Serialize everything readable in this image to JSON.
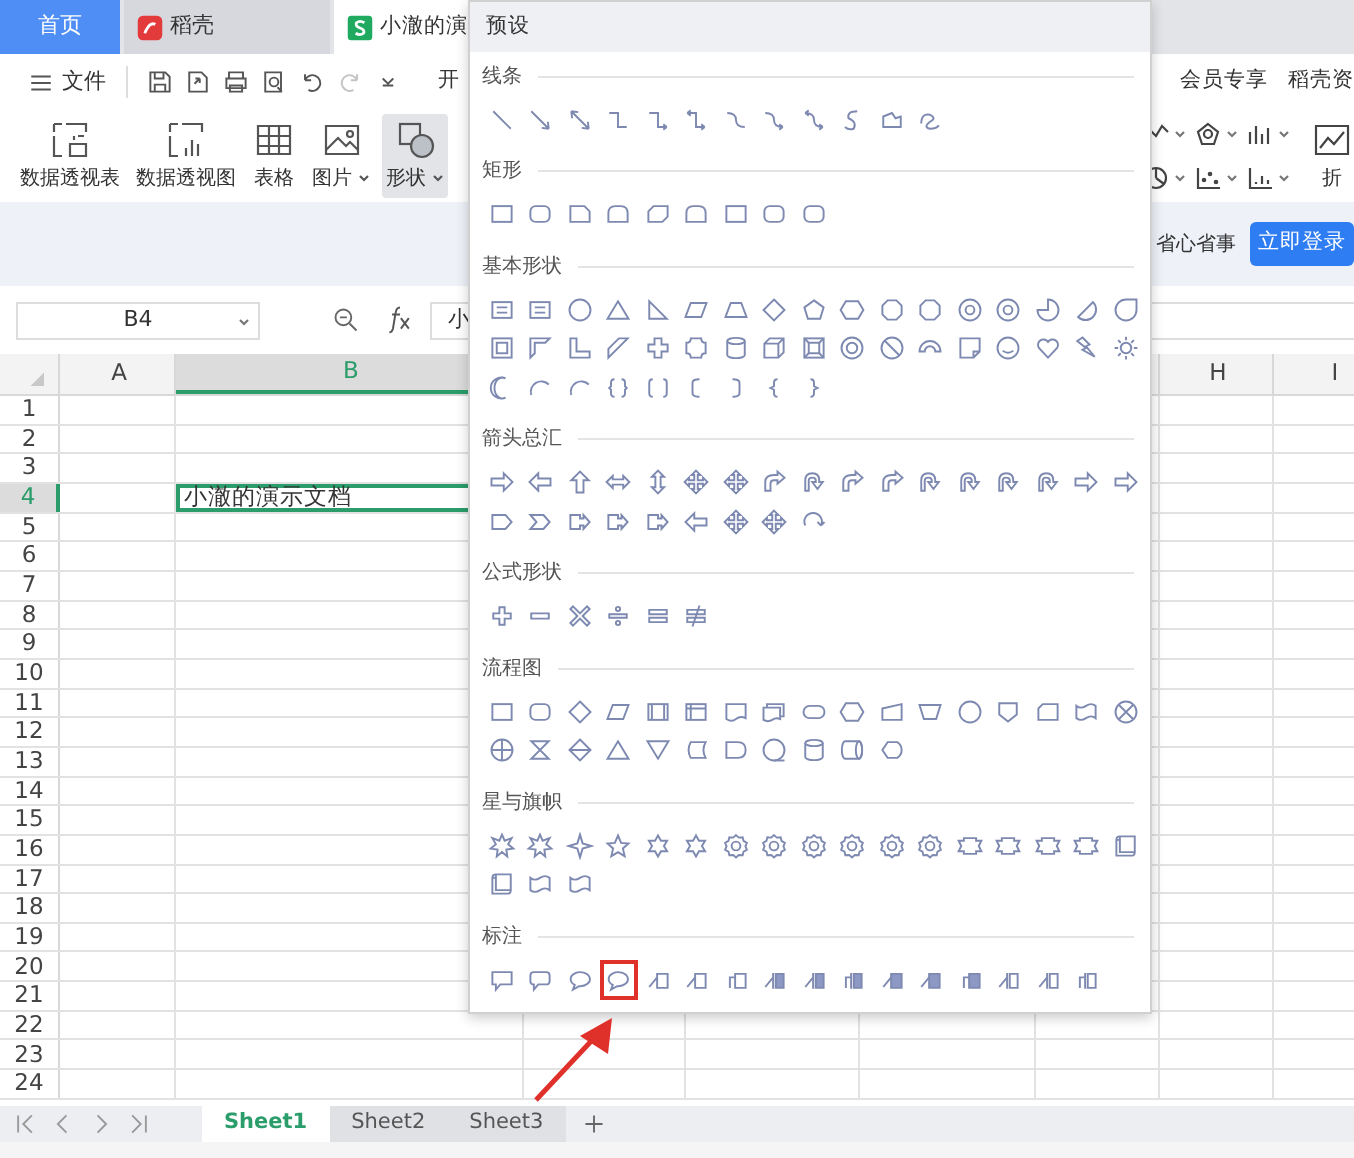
{
  "tabs": [
    {
      "label": "首页",
      "kind": "home",
      "selected": false
    },
    {
      "label": "稻壳",
      "kind": "docer",
      "selected": false
    },
    {
      "label": "小澈的演",
      "kind": "sheet",
      "selected": true
    }
  ],
  "toolbar": {
    "menu": "文件",
    "quick_access": [
      {
        "kind": "save",
        "disabled": false
      },
      {
        "kind": "export",
        "disabled": false
      },
      {
        "kind": "print",
        "disabled": false
      },
      {
        "kind": "preview",
        "disabled": false
      },
      {
        "kind": "undo",
        "disabled": false
      },
      {
        "kind": "redo",
        "disabled": true
      },
      {
        "kind": "more",
        "disabled": false
      }
    ],
    "next_tab": "开",
    "right_tabs": [
      "会员专享",
      "稻壳资"
    ]
  },
  "ribbon": [
    {
      "label": "数据透视表",
      "kind": "pivot-table",
      "caret": false,
      "selected": false
    },
    {
      "label": "数据透视图",
      "kind": "pivot-chart",
      "caret": false,
      "selected": false
    },
    {
      "label": "表格",
      "kind": "table",
      "caret": false,
      "selected": false
    },
    {
      "label": "图片",
      "kind": "picture",
      "caret": true,
      "selected": false
    },
    {
      "label": "形状",
      "kind": "shapes",
      "caret": true,
      "selected": true
    }
  ],
  "ribbon_right": {
    "label": "折"
  },
  "promo": {
    "text": "省心省事",
    "button": "立即登录"
  },
  "formula_bar": {
    "cell_ref": "B4",
    "value": "小"
  },
  "sheet": {
    "columns": [
      {
        "label": "A",
        "selected": false
      },
      {
        "label": "B",
        "selected": true
      },
      {
        "label": "H",
        "selected": false
      },
      {
        "label": "I",
        "selected": false
      }
    ],
    "rows": [
      {
        "number": "1",
        "selected": false
      },
      {
        "number": "2",
        "selected": false
      },
      {
        "number": "3",
        "selected": false
      },
      {
        "number": "4",
        "selected": true,
        "B": "小澈的演示文档"
      },
      {
        "number": "5",
        "selected": false
      },
      {
        "number": "6",
        "selected": false
      },
      {
        "number": "7",
        "selected": false
      },
      {
        "number": "8",
        "selected": false
      },
      {
        "number": "9",
        "selected": false
      },
      {
        "number": "10",
        "selected": false
      },
      {
        "number": "11",
        "selected": false
      },
      {
        "number": "12",
        "selected": false
      },
      {
        "number": "13",
        "selected": false
      },
      {
        "number": "14",
        "selected": false
      },
      {
        "number": "15",
        "selected": false
      },
      {
        "number": "16",
        "selected": false
      },
      {
        "number": "17",
        "selected": false
      },
      {
        "number": "18",
        "selected": false
      },
      {
        "number": "19",
        "selected": false
      },
      {
        "number": "20",
        "selected": false
      },
      {
        "number": "21",
        "selected": false
      },
      {
        "number": "22",
        "selected": false
      },
      {
        "number": "23",
        "selected": false
      },
      {
        "number": "24",
        "selected": false
      }
    ]
  },
  "sheet_tabs": [
    {
      "label": "Sheet1",
      "selected": true
    },
    {
      "label": "Sheet2",
      "selected": false
    },
    {
      "label": "Sheet3",
      "selected": false
    }
  ],
  "shape_menu": {
    "title": "预设",
    "sections": [
      {
        "title": "线条",
        "shapes": [
          {
            "kind": "line",
            "selected": false
          },
          {
            "kind": "arrow-line",
            "selected": false
          },
          {
            "kind": "dbl-arrow-line",
            "selected": false
          },
          {
            "kind": "elbow",
            "selected": false
          },
          {
            "kind": "elbow-arrow",
            "selected": false
          },
          {
            "kind": "elbow-dbl",
            "selected": false
          },
          {
            "kind": "curve",
            "selected": false
          },
          {
            "kind": "curve-arrow",
            "selected": false
          },
          {
            "kind": "curve-dbl",
            "selected": false
          },
          {
            "kind": "s-curve",
            "selected": false
          },
          {
            "kind": "freeform",
            "selected": false
          },
          {
            "kind": "scribble",
            "selected": false
          }
        ]
      },
      {
        "title": "矩形",
        "shapes": [
          {
            "kind": "rect",
            "selected": false
          },
          {
            "kind": "round-rect",
            "selected": false
          },
          {
            "kind": "snip-rect",
            "selected": false
          },
          {
            "kind": "round-top",
            "selected": false
          },
          {
            "kind": "snip-diag",
            "selected": false
          },
          {
            "kind": "round-top",
            "selected": false
          },
          {
            "kind": "rect",
            "selected": false
          },
          {
            "kind": "round-rect",
            "selected": false
          },
          {
            "kind": "round-rect",
            "selected": false
          }
        ]
      },
      {
        "title": "基本形状",
        "shapes": [
          {
            "kind": "text-box",
            "selected": false
          },
          {
            "kind": "text-box",
            "selected": false
          },
          {
            "kind": "oval",
            "selected": false
          },
          {
            "kind": "triangle",
            "selected": false
          },
          {
            "kind": "right-triangle",
            "selected": false
          },
          {
            "kind": "parallelogram",
            "selected": false
          },
          {
            "kind": "trapezoid",
            "selected": false
          },
          {
            "kind": "diamond",
            "selected": false
          },
          {
            "kind": "pentagon",
            "selected": false
          },
          {
            "kind": "hexagon",
            "selected": false
          },
          {
            "kind": "octagon",
            "selected": false
          },
          {
            "kind": "octagon",
            "selected": false
          },
          {
            "kind": "badge",
            "selected": false
          },
          {
            "kind": "badge",
            "selected": false
          },
          {
            "kind": "pie",
            "selected": false
          },
          {
            "kind": "chord",
            "selected": false
          },
          {
            "kind": "teardrop",
            "selected": false
          },
          {
            "kind": "frame",
            "selected": false
          },
          {
            "kind": "half-frame",
            "selected": false
          },
          {
            "kind": "l-shape",
            "selected": false
          },
          {
            "kind": "diag-stripe",
            "selected": false
          },
          {
            "kind": "cross",
            "selected": false
          },
          {
            "kind": "plaque",
            "selected": false
          },
          {
            "kind": "can",
            "selected": false
          },
          {
            "kind": "cube",
            "selected": false
          },
          {
            "kind": "bevel",
            "selected": false
          },
          {
            "kind": "donut",
            "selected": false
          },
          {
            "kind": "no-symbol",
            "selected": false
          },
          {
            "kind": "block-arc",
            "selected": false
          },
          {
            "kind": "folded-corner",
            "selected": false
          },
          {
            "kind": "smiley",
            "selected": false
          },
          {
            "kind": "heart",
            "selected": false
          },
          {
            "kind": "lightning",
            "selected": false
          },
          {
            "kind": "sun",
            "selected": false
          },
          {
            "kind": "moon",
            "selected": false
          },
          {
            "kind": "arc",
            "selected": false
          },
          {
            "kind": "arc",
            "selected": false
          },
          {
            "kind": "double-brace",
            "selected": false
          },
          {
            "kind": "double-bracket",
            "selected": false
          },
          {
            "kind": "left-bracket",
            "selected": false
          },
          {
            "kind": "right-bracket",
            "selected": false
          },
          {
            "kind": "left-brace",
            "selected": false
          },
          {
            "kind": "right-brace",
            "selected": false
          }
        ]
      },
      {
        "title": "箭头总汇",
        "shapes": [
          {
            "kind": "right-arrow",
            "selected": false
          },
          {
            "kind": "left-arrow",
            "selected": false
          },
          {
            "kind": "up-arrow",
            "selected": false
          },
          {
            "kind": "left-right-arrow",
            "selected": false
          },
          {
            "kind": "up-down-arrow",
            "selected": false
          },
          {
            "kind": "quad-arrow",
            "selected": false
          },
          {
            "kind": "quad-arrow",
            "selected": false
          },
          {
            "kind": "bent-arrow",
            "selected": false
          },
          {
            "kind": "u-turn-arrow",
            "selected": false
          },
          {
            "kind": "bent-arrow",
            "selected": false
          },
          {
            "kind": "bent-arrow",
            "selected": false
          },
          {
            "kind": "u-turn-arrow",
            "selected": false
          },
          {
            "kind": "u-turn-arrow",
            "selected": false
          },
          {
            "kind": "u-turn-arrow",
            "selected": false
          },
          {
            "kind": "u-turn-arrow",
            "selected": false
          },
          {
            "kind": "right-arrow",
            "selected": false
          },
          {
            "kind": "right-arrow",
            "selected": false
          },
          {
            "kind": "pentagon-arrow",
            "selected": false
          },
          {
            "kind": "chevron",
            "selected": false
          },
          {
            "kind": "arrow-callout",
            "selected": false
          },
          {
            "kind": "arrow-callout",
            "selected": false
          },
          {
            "kind": "arrow-callout",
            "selected": false
          },
          {
            "kind": "left-arrow",
            "selected": false
          },
          {
            "kind": "quad-arrow",
            "selected": false
          },
          {
            "kind": "quad-arrow",
            "selected": false
          },
          {
            "kind": "circular-arrow",
            "selected": false
          }
        ]
      },
      {
        "title": "公式形状",
        "shapes": [
          {
            "kind": "plus",
            "selected": false
          },
          {
            "kind": "minus",
            "selected": false
          },
          {
            "kind": "multiply",
            "selected": false
          },
          {
            "kind": "divide",
            "selected": false
          },
          {
            "kind": "equal",
            "selected": false
          },
          {
            "kind": "not-equal",
            "selected": false
          }
        ]
      },
      {
        "title": "流程图",
        "shapes": [
          {
            "kind": "rect",
            "selected": false
          },
          {
            "kind": "round-rect",
            "selected": false
          },
          {
            "kind": "diamond",
            "selected": false
          },
          {
            "kind": "parallelogram",
            "selected": false
          },
          {
            "kind": "predefined",
            "selected": false
          },
          {
            "kind": "internal-storage",
            "selected": false
          },
          {
            "kind": "document",
            "selected": false
          },
          {
            "kind": "multidocument",
            "selected": false
          },
          {
            "kind": "terminator",
            "selected": false
          },
          {
            "kind": "hexagon",
            "selected": false
          },
          {
            "kind": "manual-input",
            "selected": false
          },
          {
            "kind": "manual-operation",
            "selected": false
          },
          {
            "kind": "oval",
            "selected": false
          },
          {
            "kind": "offpage",
            "selected": false
          },
          {
            "kind": "card",
            "selected": false
          },
          {
            "kind": "punched-tape",
            "selected": false
          },
          {
            "kind": "summing-junction",
            "selected": false
          },
          {
            "kind": "or",
            "selected": false
          },
          {
            "kind": "collate",
            "selected": false
          },
          {
            "kind": "sort",
            "selected": false
          },
          {
            "kind": "triangle",
            "selected": false
          },
          {
            "kind": "merge",
            "selected": false
          },
          {
            "kind": "stored-data",
            "selected": false
          },
          {
            "kind": "delay",
            "selected": false
          },
          {
            "kind": "sequential-storage",
            "selected": false
          },
          {
            "kind": "can",
            "selected": false
          },
          {
            "kind": "direct-access",
            "selected": false
          },
          {
            "kind": "display",
            "selected": false
          }
        ]
      },
      {
        "title": "星与旗帜",
        "shapes": [
          {
            "kind": "explosion",
            "selected": false
          },
          {
            "kind": "explosion",
            "selected": false
          },
          {
            "kind": "star4",
            "selected": false
          },
          {
            "kind": "star5",
            "selected": false
          },
          {
            "kind": "star6",
            "selected": false
          },
          {
            "kind": "star6",
            "selected": false
          },
          {
            "kind": "star-badge",
            "selected": false
          },
          {
            "kind": "star-badge",
            "selected": false
          },
          {
            "kind": "star-badge",
            "selected": false
          },
          {
            "kind": "star-badge",
            "selected": false
          },
          {
            "kind": "star-badge",
            "selected": false
          },
          {
            "kind": "star-badge",
            "selected": false
          },
          {
            "kind": "ribbon",
            "selected": false
          },
          {
            "kind": "ribbon",
            "selected": false
          },
          {
            "kind": "ribbon",
            "selected": false
          },
          {
            "kind": "ribbon",
            "selected": false
          },
          {
            "kind": "scroll",
            "selected": false
          },
          {
            "kind": "scroll",
            "selected": false
          },
          {
            "kind": "wave",
            "selected": false
          },
          {
            "kind": "wave",
            "selected": false
          }
        ]
      },
      {
        "title": "标注",
        "shapes": [
          {
            "kind": "callout-rect",
            "selected": false
          },
          {
            "kind": "callout-round",
            "selected": false
          },
          {
            "kind": "callout-oval",
            "selected": false
          },
          {
            "kind": "callout-oval",
            "selected": true
          },
          {
            "kind": "line-callout",
            "selected": false
          },
          {
            "kind": "line-callout",
            "selected": false
          },
          {
            "kind": "line-callout-bent",
            "selected": false
          },
          {
            "kind": "accent-callout",
            "selected": false
          },
          {
            "kind": "accent-callout",
            "selected": false
          },
          {
            "kind": "accent-callout-bent",
            "selected": false
          },
          {
            "kind": "filled-callout",
            "selected": false
          },
          {
            "kind": "filled-callout",
            "selected": false
          },
          {
            "kind": "filled-callout-bent",
            "selected": false
          },
          {
            "kind": "border-callout",
            "selected": false
          },
          {
            "kind": "border-callout",
            "selected": false
          },
          {
            "kind": "border-callout-bent",
            "selected": false
          }
        ]
      }
    ]
  }
}
